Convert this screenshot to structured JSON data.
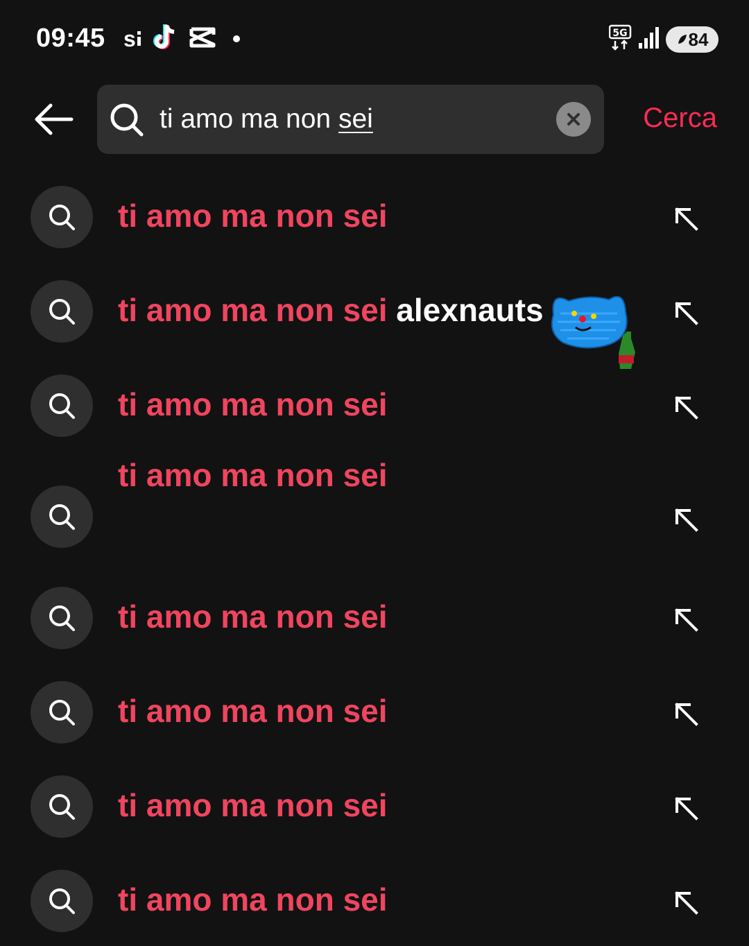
{
  "status_bar": {
    "time": "09:45",
    "si_label": "s",
    "network_label": "5G",
    "battery": "84"
  },
  "search": {
    "query_plain": "ti amo ma non ",
    "query_underlined": "sei",
    "submit_label": "Cerca"
  },
  "suggestions": [
    {
      "match": "ti amo ma non sei",
      "extra": ""
    },
    {
      "match": "ti amo ma non sei",
      "extra": " alexnauts"
    },
    {
      "match": "ti amo ma non sei",
      "extra": ""
    },
    {
      "match": "ti amo ma non sei",
      "extra": ""
    },
    {
      "match": "ti amo ma non sei",
      "extra": ""
    },
    {
      "match": "ti amo ma non sei",
      "extra": ""
    },
    {
      "match": "ti amo ma non sei",
      "extra": ""
    },
    {
      "match": "ti amo ma non sei",
      "extra": ""
    }
  ],
  "colors": {
    "background": "#121212",
    "accent": "#fe2c55",
    "match_text": "#f0455f",
    "field_bg": "#2f2f2f"
  },
  "icons": {
    "back": "arrow-left-icon",
    "search": "search-icon",
    "clear": "close-circle-icon",
    "fill": "arrow-up-left-icon",
    "app_1": "tiktok-icon",
    "app_2": "capcut-icon",
    "signal": "signal-icon",
    "battery": "battery-icon"
  }
}
